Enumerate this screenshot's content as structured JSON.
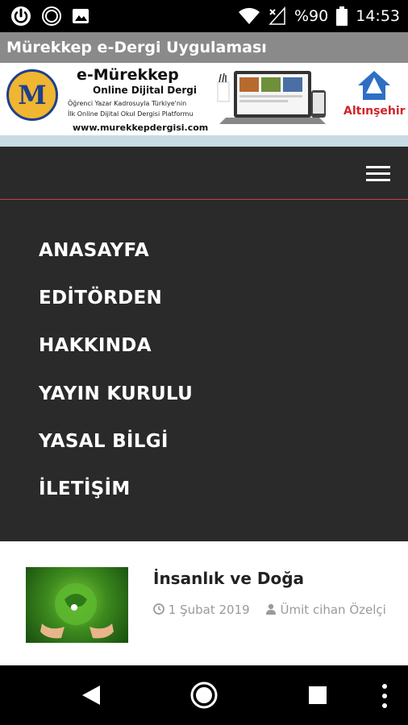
{
  "status_bar": {
    "battery_percent": "%90",
    "time": "14:53",
    "icons": [
      "power-icon",
      "circle-icon",
      "image-icon",
      "wifi-icon",
      "signal-icon",
      "battery-icon"
    ]
  },
  "app": {
    "title": "Mürekkep e-Dergi Uygulaması"
  },
  "banner": {
    "logo_letter": "M",
    "title": "e-Mürekkep",
    "subtitle": "Online Dijital Dergi",
    "line1": "Öğrenci Yazar Kadrosuyla Türkiye'nin",
    "line2": "İlk Online Dijital Okul Dergisi Platformu",
    "url": "www.murekkepdergisi.com",
    "partner": "Altınşehir"
  },
  "menu": {
    "items": [
      {
        "label": "ANASAYFA"
      },
      {
        "label": "EDİTÖRDEN"
      },
      {
        "label": "HAKKINDA"
      },
      {
        "label": "YAYIN KURULU"
      },
      {
        "label": "YASAL BİLGİ"
      },
      {
        "label": "İLETİŞİM"
      }
    ]
  },
  "article": {
    "title": "İnsanlık ve Doğa",
    "date": "1 Şubat 2019",
    "author": "Ümit cihan Özelçi"
  },
  "colors": {
    "nav_bg": "#2a2a2a",
    "accent_line": "#c94040",
    "title_bar": "#8a8a8a"
  }
}
